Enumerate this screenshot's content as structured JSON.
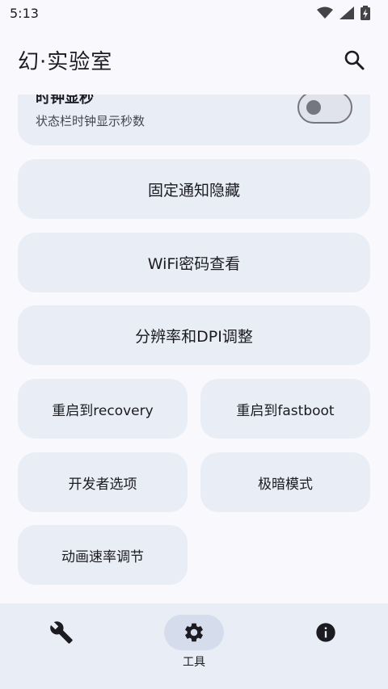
{
  "status_bar": {
    "time": "5:13"
  },
  "app_bar": {
    "title": "幻·实验室"
  },
  "settings": {
    "clock_seconds": {
      "title": "时钟显秒",
      "subtitle": "状态栏时钟显示秒数",
      "enabled": false
    }
  },
  "tools": {
    "hide_fixed_notification": "固定通知隐藏",
    "wifi_password": "WiFi密码查看",
    "resolution_dpi": "分辨率和DPI调整",
    "reboot_recovery": "重启到recovery",
    "reboot_fastboot": "重启到fastboot",
    "developer_options": "开发者选项",
    "extra_dim": "极暗模式",
    "animation_speed": "动画速率调节"
  },
  "bottom_nav": {
    "items": [
      {
        "icon": "wrench-icon",
        "label": ""
      },
      {
        "icon": "gear-icon",
        "label": "工具",
        "active": true
      },
      {
        "icon": "info-icon",
        "label": ""
      }
    ]
  },
  "colors": {
    "card": "#e9edf5",
    "background": "#f8f8fd",
    "nav_active": "#d5dcec"
  }
}
